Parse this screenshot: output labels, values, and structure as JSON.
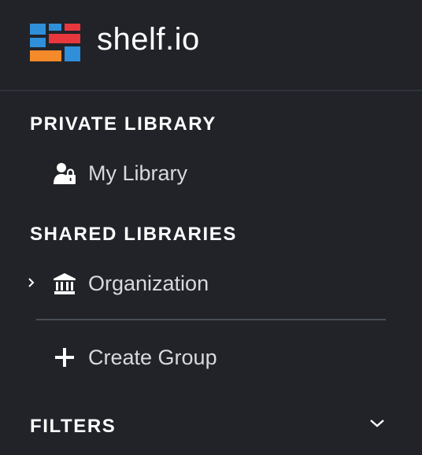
{
  "brand": {
    "name": "shelf.io",
    "logo_colors": [
      "#2f8fd8",
      "#e8373d",
      "#f58a2a"
    ]
  },
  "sections": {
    "private": {
      "title": "PRIVATE LIBRARY"
    },
    "shared": {
      "title": "SHARED LIBRARIES"
    },
    "filters": {
      "title": "FILTERS"
    }
  },
  "nav": {
    "my_library": {
      "label": "My Library",
      "icon": "user-lock-icon"
    },
    "organization": {
      "label": "Organization",
      "icon": "bank-icon",
      "expand_icon": "chevron-right-icon"
    },
    "create_group": {
      "label": "Create Group",
      "icon": "plus-icon"
    }
  },
  "filters_toggle_icon": "chevron-down-icon"
}
